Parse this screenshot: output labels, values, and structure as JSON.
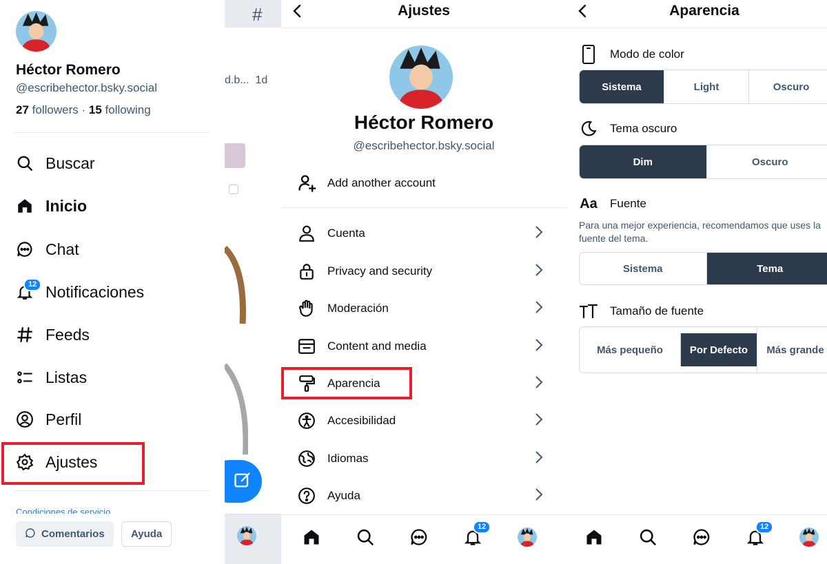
{
  "drawer": {
    "name": "Héctor Romero",
    "handle": "@escribehector.bsky.social",
    "followers_count": "27",
    "followers_label": "followers",
    "separator": "·",
    "following_count": "15",
    "following_label": "following",
    "nav": [
      {
        "label": "Buscar",
        "icon": "search-icon"
      },
      {
        "label": "Inicio",
        "icon": "home-icon"
      },
      {
        "label": "Chat",
        "icon": "chat-icon"
      },
      {
        "label": "Notificaciones",
        "icon": "bell-icon",
        "badge": "12"
      },
      {
        "label": "Feeds",
        "icon": "hash-icon"
      },
      {
        "label": "Listas",
        "icon": "list-icon"
      },
      {
        "label": "Perfil",
        "icon": "profile-icon"
      },
      {
        "label": "Ajustes",
        "icon": "gear-icon"
      }
    ],
    "terms_link": "Condiciones de servicio",
    "feedback_button": "Comentarios",
    "help_button": "Ayuda"
  },
  "feed_peek": {
    "post_snippet": "d.b...",
    "post_time": "1d"
  },
  "settings": {
    "title": "Ajustes",
    "name": "Héctor Romero",
    "handle": "@escribehector.bsky.social",
    "add_account": "Add another account",
    "items": [
      {
        "label": "Cuenta",
        "icon": "person-icon"
      },
      {
        "label": "Privacy and security",
        "icon": "lock-icon"
      },
      {
        "label": "Moderación",
        "icon": "hand-icon"
      },
      {
        "label": "Content and media",
        "icon": "window-icon"
      },
      {
        "label": "Aparencia",
        "icon": "paint-roller-icon"
      },
      {
        "label": "Accesibilidad",
        "icon": "accessibility-icon"
      },
      {
        "label": "Idiomas",
        "icon": "globe-icon"
      },
      {
        "label": "Ayuda",
        "icon": "help-icon"
      }
    ],
    "notif_badge": "12"
  },
  "appearance": {
    "title": "Aparencia",
    "color_mode": {
      "label": "Modo de color",
      "options": [
        "Sistema",
        "Light",
        "Oscuro"
      ],
      "selected": "Sistema"
    },
    "dark_theme": {
      "label": "Tema oscuro",
      "options": [
        "Dim",
        "Oscuro"
      ],
      "selected": "Dim"
    },
    "font": {
      "icon_text": "Aa",
      "label": "Fuente",
      "description": "Para una mejor experiencia, recomendamos que uses la fuente del tema.",
      "options": [
        "Sistema",
        "Tema"
      ],
      "selected": "Tema"
    },
    "font_size": {
      "label": "Tamaño de fuente",
      "options": [
        "Más pequeño",
        "Por Defecto",
        "Más grande"
      ],
      "selected": "Por Defecto"
    },
    "notif_badge": "12"
  },
  "colors": {
    "accent": "#1083fe",
    "selected_segment": "#2c3a4c",
    "highlight_box": "#e3202b"
  }
}
